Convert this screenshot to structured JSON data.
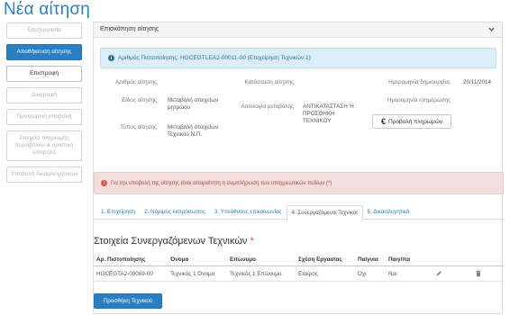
{
  "page": {
    "title": "Νέα αίτηση"
  },
  "sidebar": {
    "items": [
      {
        "label": "Επεξεργασία",
        "state": "disabled"
      },
      {
        "label": "Αποθήκευση αίτησης",
        "state": "primary"
      },
      {
        "label": "Επιστροφή",
        "state": "active"
      },
      {
        "label": "Διαγραφή",
        "state": "disabled"
      },
      {
        "label": "Προσωρινή υποβολή",
        "state": "disabled"
      },
      {
        "label": "Στοιχεία πληρωμής παραβόλου & οριστική υποβολή",
        "state": "disabled"
      },
      {
        "label": "Υποβολή δικαιολογητικών",
        "state": "disabled"
      }
    ]
  },
  "panel": {
    "heading": "Επισκόπηση αίτησης",
    "info": "Αριθμός Πιστοποίησης: HGCEGTLEA2-00011-00 (Επιχείρηση Τεχνικών 1)",
    "fields": {
      "app_number_label": "Αριθμός αίτησης",
      "app_type_label": "Είδος αίτησης",
      "app_type_value": "Μεταβολή στοιχείων μητρώου",
      "type_label": "Τύπος αίτησης",
      "type_value": "Μεταβολή στοιχείων Τεχνικού Ν.Π.",
      "status_label": "Κατάσταση αίτησης",
      "reason_label": "Αιτιολογία μεταβολής",
      "reason_value": "ΑΝΤΙΚΑΤΑΣΤΑΣΗ Ή ΠΡΟΣΘΗΚΗ ΤΕΧΝΙΚΟΥ",
      "created_label": "Ημερομηνία δημιουργίας",
      "created_value": "20/11/2014",
      "updated_label": "Ημερομηνία ενημέρωσης"
    },
    "payment_button": "Προβολή πληρωμών",
    "error": "Για την υποβολή της αίτησης είναι απαραίτητη η συμπλήρωση των υποχρεωτικών πεδίων (*)",
    "tabs": [
      {
        "label": "1. Επιχείρηση",
        "active": false
      },
      {
        "label": "2. Νόμιμος εκπρόσωπος",
        "active": false
      },
      {
        "label": "3. Υπεύθυνος επικοινωνίας",
        "active": false
      },
      {
        "label": "4. Συνεργαζόμενοι Τεχνικοί",
        "active": true
      },
      {
        "label": "5. Δικαιολογητικά",
        "active": false
      }
    ],
    "section_title": "Στοιχεία Συνεργαζόμενων Τεχνικών",
    "required_mark": "*",
    "table": {
      "headers": [
        "Αρ. Πιστοποίησης",
        "Όνομα",
        "Επώνυμο",
        "Σχέση Εργασίας",
        "Παίγνια",
        "Παιγ/πα"
      ],
      "rows": [
        [
          "HGCEGTA2-00069-00",
          "Τεχνικός 1 Όνομα",
          "Τεχνικός 1 Επώνυμο",
          "Εταίρος",
          "Όχι",
          "Ναι"
        ]
      ]
    },
    "add_button": "Προσθήκη Τεχνικού"
  },
  "colors": {
    "accent": "#2a7fc2",
    "info_bg": "#d9eef9",
    "error_bg": "#f2dede"
  }
}
